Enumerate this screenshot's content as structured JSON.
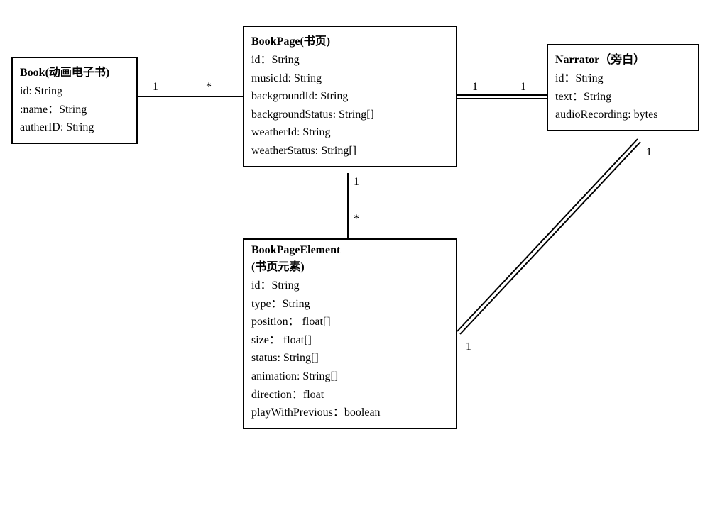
{
  "classes": {
    "book": {
      "title": "Book(动画电子书)",
      "attrs": [
        "id: String",
        ":name：String",
        "autherID: String"
      ]
    },
    "bookPage": {
      "title": "BookPage(书页)",
      "attrs": [
        "id：String",
        "musicId: String",
        "backgroundId: String",
        "backgroundStatus: String[]",
        "weatherId: String",
        "weatherStatus: String[]"
      ]
    },
    "narrator": {
      "title": "Narrator（旁白）",
      "attrs": [
        "id：String",
        "text：String",
        "audioRecording: bytes"
      ]
    },
    "bookPageElement": {
      "title": "BookPageElement",
      "subtitle": "(书页元素)",
      "attrs": [
        "id：String",
        "type：String",
        "position： float[]",
        "size： float[]",
        "status: String[]",
        "animation: String[]",
        "direction：float",
        "playWithPrevious：boolean"
      ]
    }
  },
  "multiplicities": {
    "book_to_page_left": "1",
    "book_to_page_right": "*",
    "page_to_narrator_left": "1",
    "page_to_narrator_right": "1",
    "page_to_element_top": "1",
    "page_to_element_bottom": "*",
    "element_to_narrator_left": "1",
    "element_to_narrator_right": "1"
  }
}
